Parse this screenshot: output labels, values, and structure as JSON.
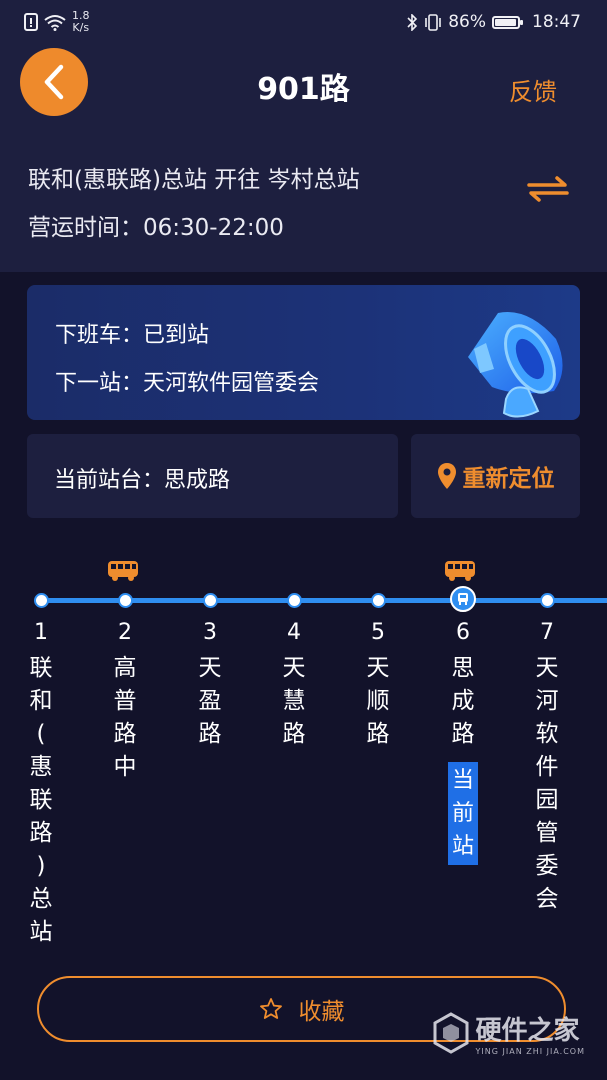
{
  "status_bar": {
    "speed_value": "1.8",
    "speed_unit": "K/s",
    "battery": "86%",
    "battery_level": 0.86,
    "time": "18:47"
  },
  "header": {
    "title": "901路",
    "feedback_label": "反馈",
    "direction": "联和(惠联路)总站 开往 岑村总站",
    "hours": "营运时间：06:30-22:00"
  },
  "notice": {
    "next_bus": "下班车：已到站",
    "next_stop": "下一站：天河软件园管委会"
  },
  "current_station": {
    "label": "当前站台：思成路",
    "relocate_label": "重新定位"
  },
  "stops": [
    {
      "num": "1",
      "name": "联\n和\n(\n惠\n联\n路\n)\n总\n站"
    },
    {
      "num": "2",
      "name": "高\n普\n路\n中"
    },
    {
      "num": "3",
      "name": "天\n盈\n路"
    },
    {
      "num": "4",
      "name": "天\n慧\n路"
    },
    {
      "num": "5",
      "name": "天\n顺\n路"
    },
    {
      "num": "6",
      "name": "思\n成\n路"
    },
    {
      "num": "7",
      "name": "天\n河\n软\n件\n园\n管\n委\n会"
    }
  ],
  "current_badge": "当\n前\n站",
  "favorite_label": "收藏",
  "watermark": {
    "text": "硬件之家",
    "sub": "YING JIAN ZHI JIA.COM"
  },
  "colors": {
    "accent": "#ef8d2e",
    "route_line": "#2f8ef0",
    "background": "#12122a",
    "panel": "#1d1f3f"
  }
}
